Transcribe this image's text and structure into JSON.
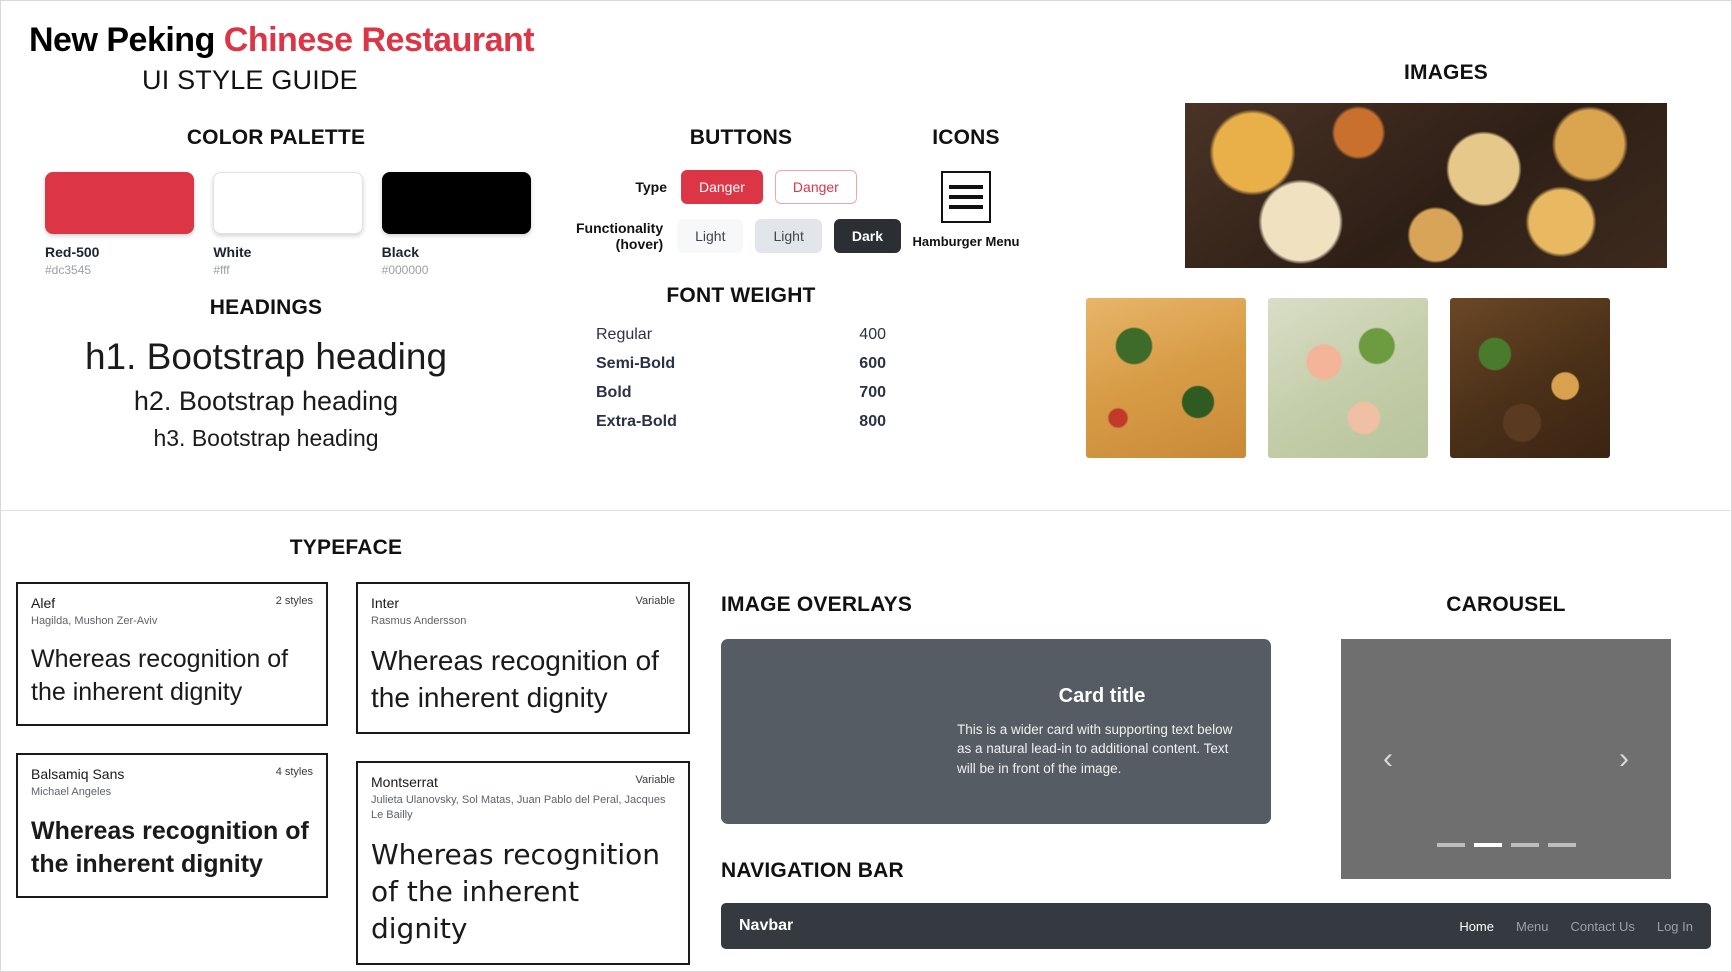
{
  "header": {
    "brand_primary": "New Peking ",
    "brand_accent": "Chinese Restaurant",
    "subtitle": "UI STYLE GUIDE"
  },
  "color_palette": {
    "title": "COLOR PALETTE",
    "swatches": [
      {
        "name": "Red-500",
        "hex": "#dc3545"
      },
      {
        "name": "White",
        "hex": "#fff"
      },
      {
        "name": "Black",
        "hex": "#000000"
      }
    ]
  },
  "headings": {
    "title": "HEADINGS",
    "samples": [
      "h1. Bootstrap heading",
      "h2. Bootstrap heading",
      "h3. Bootstrap heading"
    ]
  },
  "buttons": {
    "title": "BUTTONS",
    "row_type_label": "Type",
    "row_functionality_label": "Functionality",
    "row_functionality_sub": "(hover)",
    "danger_solid": "Danger",
    "danger_outline": "Danger",
    "light_1": "Light",
    "light_2": "Light",
    "dark": "Dark"
  },
  "font_weight": {
    "title": "FONT WEIGHT",
    "rows": [
      {
        "name": "Regular",
        "value": "400"
      },
      {
        "name": "Semi-Bold",
        "value": "600"
      },
      {
        "name": "Bold",
        "value": "700"
      },
      {
        "name": "Extra-Bold",
        "value": "800"
      }
    ]
  },
  "icons": {
    "title": "ICONS",
    "hamburger_caption": "Hamburger Menu"
  },
  "images": {
    "title": "IMAGES"
  },
  "typeface": {
    "title": "TYPEFACE",
    "cards": [
      {
        "name": "Alef",
        "author": "Hagilda, Mushon Zer-Aviv",
        "styles": "2 styles",
        "sample": "Whereas recognition of the inherent dignity"
      },
      {
        "name": "Inter",
        "author": "Rasmus Andersson",
        "styles": "Variable",
        "sample": "Whereas recognition of the inherent dignity"
      },
      {
        "name": "Balsamiq Sans",
        "author": "Michael Angeles",
        "styles": "4 styles",
        "sample": "Whereas recognition of the inherent dignity"
      },
      {
        "name": "Montserrat",
        "author": "Julieta Ulanovsky, Sol Matas, Juan Pablo del Peral, Jacques Le Bailly",
        "styles": "Variable",
        "sample": "Whereas recognition of the inherent dignity"
      }
    ]
  },
  "image_overlays": {
    "title": "IMAGE OVERLAYS",
    "card_title": "Card title",
    "card_text": "This is a wider card with supporting text below as a natural lead-in to additional content. Text will be in front of the image."
  },
  "carousel": {
    "title": "CAROUSEL",
    "prev_icon": "‹",
    "next_icon": "›",
    "slide_count": 4,
    "active_slide": 2
  },
  "navigation_bar": {
    "title": "NAVIGATION BAR",
    "brand": "Navbar",
    "links": [
      "Home",
      "Menu",
      "Contact Us",
      "Log In"
    ],
    "active_link": "Home"
  }
}
